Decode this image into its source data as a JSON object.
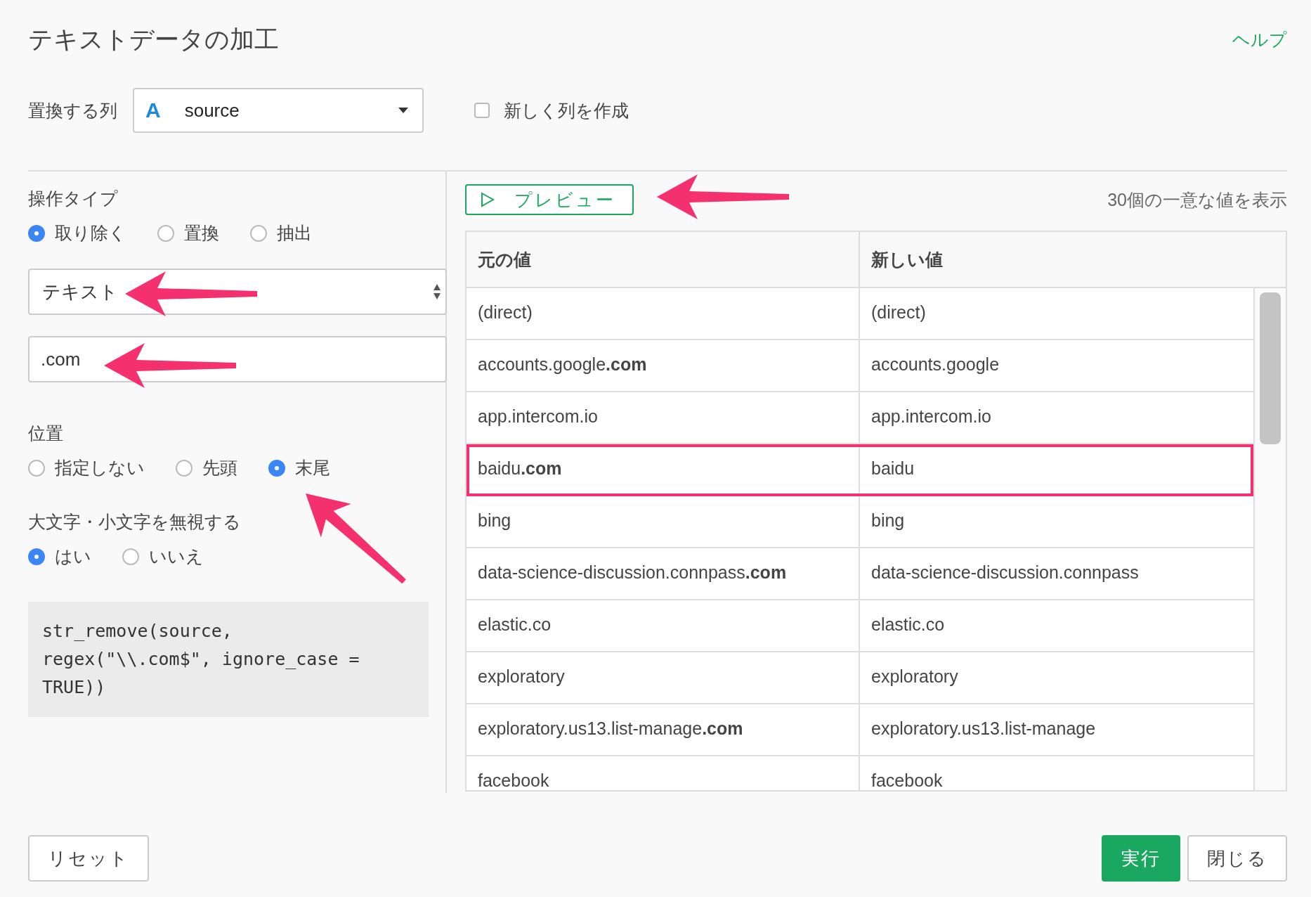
{
  "dialog": {
    "title": "テキストデータの加工",
    "help_link": "ヘルプ"
  },
  "column_row": {
    "label": "置換する列",
    "select": {
      "type_icon": "A",
      "value": "source"
    },
    "new_column": {
      "label": "新しく列を作成",
      "checked": false
    }
  },
  "operation": {
    "label": "操作タイプ",
    "options": [
      {
        "label": "取り除く",
        "selected": true
      },
      {
        "label": "置換",
        "selected": false
      },
      {
        "label": "抽出",
        "selected": false
      }
    ],
    "target_select": {
      "value": "テキスト"
    },
    "pattern_field": {
      "value": ".com"
    }
  },
  "position": {
    "label": "位置",
    "options": [
      {
        "label": "指定しない",
        "selected": false
      },
      {
        "label": "先頭",
        "selected": false
      },
      {
        "label": "末尾",
        "selected": true
      }
    ]
  },
  "ignore_case": {
    "label": "大文字・小文字を無視する",
    "options": [
      {
        "label": "はい",
        "selected": true
      },
      {
        "label": "いいえ",
        "selected": false
      }
    ]
  },
  "code": [
    "str_remove(source,",
    "regex(\"\\\\.com$\", ignore_case =",
    "TRUE))"
  ],
  "preview": {
    "button": "プレビュー",
    "summary": "30個の一意な値を表示"
  },
  "table": {
    "columns": [
      "元の値",
      "新しい値"
    ],
    "rows": [
      {
        "original": "(direct)",
        "new": "(direct)",
        "highlighted": false
      },
      {
        "original": "accounts.google**.com**",
        "new": "accounts.google",
        "highlighted": false
      },
      {
        "original": "app.intercom.io",
        "new": "app.intercom.io",
        "highlighted": false
      },
      {
        "original": "baidu**.com**",
        "new": "baidu",
        "highlighted": true
      },
      {
        "original": "bing",
        "new": "bing",
        "highlighted": false
      },
      {
        "original": "data-science-discussion.connpass**.com**",
        "new": "data-science-discussion.connpass",
        "highlighted": false
      },
      {
        "original": "elastic.co",
        "new": "elastic.co",
        "highlighted": false
      },
      {
        "original": "exploratory",
        "new": "exploratory",
        "highlighted": false
      },
      {
        "original": "exploratory.us13.list-manage**.com**",
        "new": "exploratory.us13.list-manage",
        "highlighted": false
      },
      {
        "original": "facebook",
        "new": "facebook",
        "highlighted": false
      }
    ]
  },
  "footer": {
    "reset": "リセット",
    "run": "実行",
    "close": "閉じる"
  }
}
